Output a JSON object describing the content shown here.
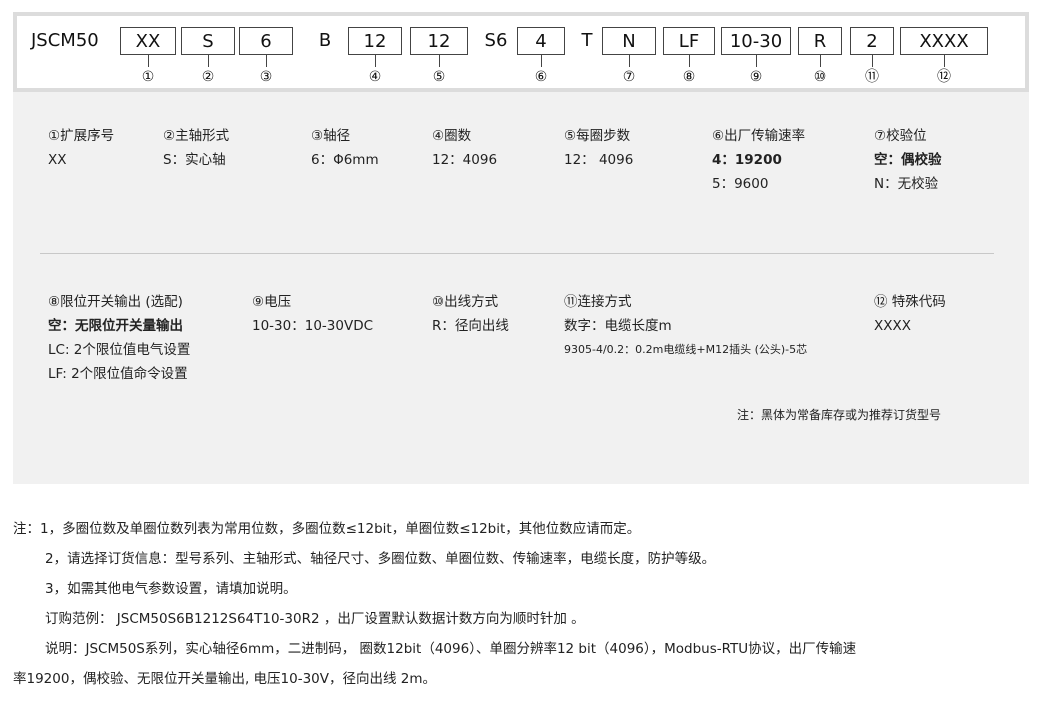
{
  "code_bar": {
    "prefix": "JSCM50",
    "segments": [
      {
        "text": "XX",
        "boxed": true,
        "num": "①"
      },
      {
        "text": "S",
        "boxed": true,
        "num": "②"
      },
      {
        "text": "6",
        "boxed": true,
        "num": "③"
      },
      {
        "text": "B",
        "boxed": false,
        "num": ""
      },
      {
        "text": "12",
        "boxed": true,
        "num": "④"
      },
      {
        "text": "12",
        "boxed": true,
        "num": "⑤"
      },
      {
        "text": "S6",
        "boxed": false,
        "num": ""
      },
      {
        "text": "4",
        "boxed": true,
        "num": "⑥"
      },
      {
        "text": "T",
        "boxed": false,
        "num": ""
      },
      {
        "text": "N",
        "boxed": true,
        "num": "⑦"
      },
      {
        "text": "LF",
        "boxed": true,
        "num": "⑧"
      },
      {
        "text": "10-30",
        "boxed": true,
        "num": "⑨"
      },
      {
        "text": "R",
        "boxed": true,
        "num": "⑩"
      },
      {
        "text": "2",
        "boxed": true,
        "num": "⑪"
      },
      {
        "text": "XXXX",
        "boxed": true,
        "num": "⑫"
      }
    ]
  },
  "fields_row1": [
    {
      "title": "①扩展序号",
      "lines": [
        {
          "text": "XX",
          "bold": false
        }
      ]
    },
    {
      "title": "②主轴形式",
      "lines": [
        {
          "text": "S：实心轴",
          "bold": false
        }
      ]
    },
    {
      "title": "③轴径",
      "lines": [
        {
          "text": "6：Φ6mm",
          "bold": false
        }
      ]
    },
    {
      "title": "④圈数",
      "lines": [
        {
          "text": "12：4096",
          "bold": false
        }
      ]
    },
    {
      "title": "⑤每圈步数",
      "lines": [
        {
          "text": "12： 4096",
          "bold": false
        }
      ]
    },
    {
      "title": "⑥出厂传输速率",
      "lines": [
        {
          "text": "4：19200",
          "bold": true
        },
        {
          "text": "5：9600",
          "bold": false
        }
      ]
    },
    {
      "title": "⑦校验位",
      "lines": [
        {
          "text": "空：偶校验",
          "bold": true
        },
        {
          "text": "N：无校验",
          "bold": false
        }
      ]
    }
  ],
  "fields_row2": [
    {
      "title": "⑧限位开关输出 (选配)",
      "lines": [
        {
          "text": "空：无限位开关量输出",
          "bold": true
        },
        {
          "text": "LC: 2个限位值电气设置",
          "bold": false
        },
        {
          "text": "LF: 2个限位值命令设置",
          "bold": false
        }
      ]
    },
    {
      "title": "⑨电压",
      "lines": [
        {
          "text": "10-30：10-30VDC",
          "bold": false
        }
      ]
    },
    {
      "title": "⑩出线方式",
      "lines": [
        {
          "text": "R：径向出线",
          "bold": false
        }
      ]
    },
    {
      "title": "⑪连接方式",
      "lines": [
        {
          "text": "数字：电缆长度m",
          "bold": false
        },
        {
          "text": "9305-4/0.2：0.2m电缆线+M12插头 (公头)-5芯",
          "bold": false,
          "small": true
        }
      ]
    },
    {
      "title": "⑫ 特殊代码",
      "lines": [
        {
          "text": "XXXX",
          "bold": false
        }
      ]
    }
  ],
  "info_note": "注：黑体为常备库存或为推荐订货型号",
  "notes": [
    "注：1，多圈位数及单圈位数列表为常用位数，多圈位数≤12bit，单圈位数≤12bit，其他位数应请而定。",
    "2，请选择订货信息：型号系列、主轴形式、轴径尺寸、多圈位数、单圈位数、传输速率，电缆长度，防护等级。",
    "3，如需其他电气参数设置，请填加说明。",
    "订购范例： JSCM50S6B1212S64T10-30R2 ，出厂设置默认数据计数方向为顺时针加 。",
    "说明：JSCM50S系列，实心轴径6mm，二进制码，  圈数12bit（4096）、单圈分辨率12 bit（4096），Modbus-RTU协议，出厂传输速",
    "率19200，偶校验、无限位开关量输出, 电压10-30V，径向出线 2m。"
  ]
}
